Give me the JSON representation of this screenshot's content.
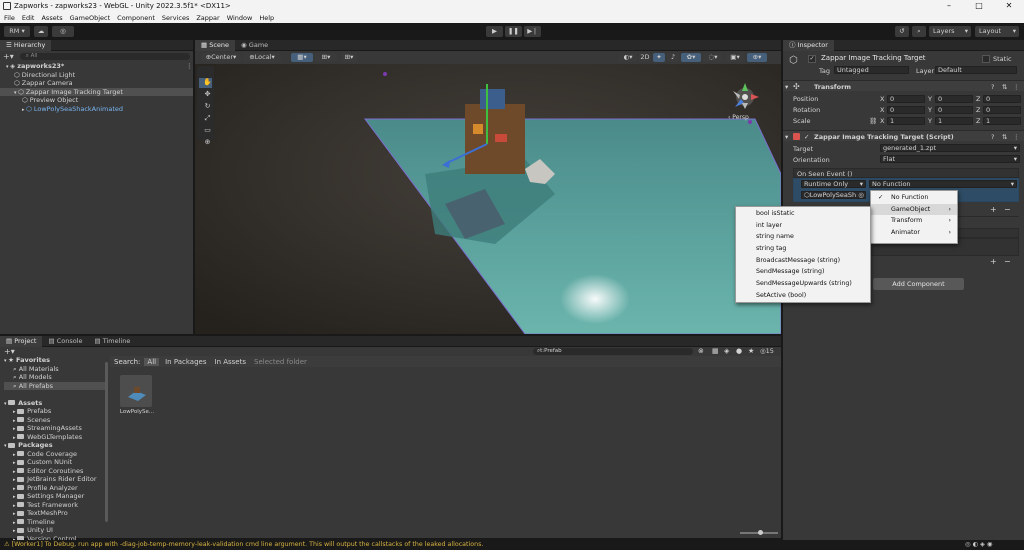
{
  "window": {
    "title": "Zapworks - zapworks23 - WebGL - Unity 2022.3.5f1* <DX11>",
    "controls": [
      "–",
      "□",
      "✕"
    ]
  },
  "menubar": {
    "items": [
      "File",
      "Edit",
      "Assets",
      "GameObject",
      "Component",
      "Services",
      "Zappar",
      "Window",
      "Help"
    ]
  },
  "toolbar": {
    "account": "RM ▾",
    "layers": "Layers",
    "layout": "Layout"
  },
  "hierarchy": {
    "tab": "Hierarchy",
    "search_placeholder": "All",
    "items": [
      {
        "label": "zapworks23*",
        "indent": 0
      },
      {
        "label": "Directional Light",
        "indent": 1
      },
      {
        "label": "Zappar Camera",
        "indent": 1
      },
      {
        "label": "Zappar Image Tracking Target",
        "indent": 1,
        "selected": true
      },
      {
        "label": "Preview Object",
        "indent": 2
      },
      {
        "label": "LowPolySeaShackAnimated",
        "indent": 2,
        "prefab": true
      }
    ]
  },
  "scene": {
    "tabs": [
      "Scene",
      "Game"
    ],
    "pivot": "Center",
    "space": "Local",
    "persp_label": "‹ Persp"
  },
  "inspector": {
    "tab": "Inspector",
    "object_name": "Zappar Image Tracking Target",
    "static_label": "Static",
    "tag_label": "Tag",
    "tag_value": "Untagged",
    "layer_label": "Layer",
    "layer_value": "Default",
    "transform": {
      "title": "Transform",
      "rows": [
        {
          "label": "Position",
          "x": "0",
          "y": "0",
          "z": "0"
        },
        {
          "label": "Rotation",
          "x": "0",
          "y": "0",
          "z": "0"
        },
        {
          "label": "Scale",
          "x": "1",
          "y": "1",
          "z": "1"
        }
      ]
    },
    "script": {
      "title": "Zappar Image Tracking Target (Script)",
      "target_label": "Target",
      "target_value": "generated_1.zpt",
      "orientation_label": "Orientation",
      "orientation_value": "Flat",
      "event_label": "On Seen Event ()",
      "runtime_value": "Runtime Only",
      "function_value": "No Function",
      "object_value": "LowPolySeaSh"
    },
    "add_component": "Add Component"
  },
  "function_menu": {
    "items": [
      {
        "label": "No Function",
        "checked": true
      },
      {
        "label": "GameObject",
        "sub": true,
        "hl": true
      },
      {
        "label": "Transform",
        "sub": true
      },
      {
        "label": "Animator",
        "sub": true
      }
    ]
  },
  "gameobject_menu": {
    "items": [
      "bool isStatic",
      "int layer",
      "string name",
      "string tag",
      "BroadcastMessage (string)",
      "SendMessage (string)",
      "SendMessageUpwards (string)",
      "SetActive (bool)"
    ]
  },
  "project": {
    "tabs": [
      "Project",
      "Console",
      "Timeline"
    ],
    "search_value": "t:Prefab",
    "search_label": "Search:",
    "scopes": [
      "All",
      "In Packages",
      "In Assets",
      "Selected folder"
    ],
    "badge": "15",
    "tree": [
      {
        "label": "Favorites",
        "indent": 0,
        "bold": true,
        "star": true
      },
      {
        "label": "All Materials",
        "indent": 1,
        "search": true
      },
      {
        "label": "All Models",
        "indent": 1,
        "search": true
      },
      {
        "label": "All Prefabs",
        "indent": 1,
        "search": true,
        "selected": true
      },
      {
        "label": "",
        "indent": 0
      },
      {
        "label": "Assets",
        "indent": 0,
        "bold": true,
        "folder": true
      },
      {
        "label": "Prefabs",
        "indent": 1,
        "folder": true
      },
      {
        "label": "Scenes",
        "indent": 1,
        "folder": true
      },
      {
        "label": "StreamingAssets",
        "indent": 1,
        "folder": true
      },
      {
        "label": "WebGLTemplates",
        "indent": 1,
        "folder": true
      },
      {
        "label": "Packages",
        "indent": 0,
        "bold": true,
        "folder": true
      },
      {
        "label": "Code Coverage",
        "indent": 1,
        "folder": true
      },
      {
        "label": "Custom NUnit",
        "indent": 1,
        "folder": true
      },
      {
        "label": "Editor Coroutines",
        "indent": 1,
        "folder": true
      },
      {
        "label": "JetBrains Rider Editor",
        "indent": 1,
        "folder": true
      },
      {
        "label": "Profile Analyzer",
        "indent": 1,
        "folder": true
      },
      {
        "label": "Settings Manager",
        "indent": 1,
        "folder": true
      },
      {
        "label": "Test Framework",
        "indent": 1,
        "folder": true
      },
      {
        "label": "TextMeshPro",
        "indent": 1,
        "folder": true
      },
      {
        "label": "Timeline",
        "indent": 1,
        "folder": true
      },
      {
        "label": "Unity UI",
        "indent": 1,
        "folder": true
      },
      {
        "label": "Version Control",
        "indent": 1,
        "folder": true
      }
    ],
    "asset": {
      "label": "LowPolySe..."
    }
  },
  "status": {
    "message": "[Worker1] To Debug, run app with -diag-job-temp-memory-leak-validation cmd line argument. This will output the callstacks of the leaked allocations."
  },
  "colors": {
    "accent": "#3a79bb",
    "selection": "#2c5d87",
    "menu_bg": "#f2f2f2",
    "warning": "#d7b341"
  }
}
